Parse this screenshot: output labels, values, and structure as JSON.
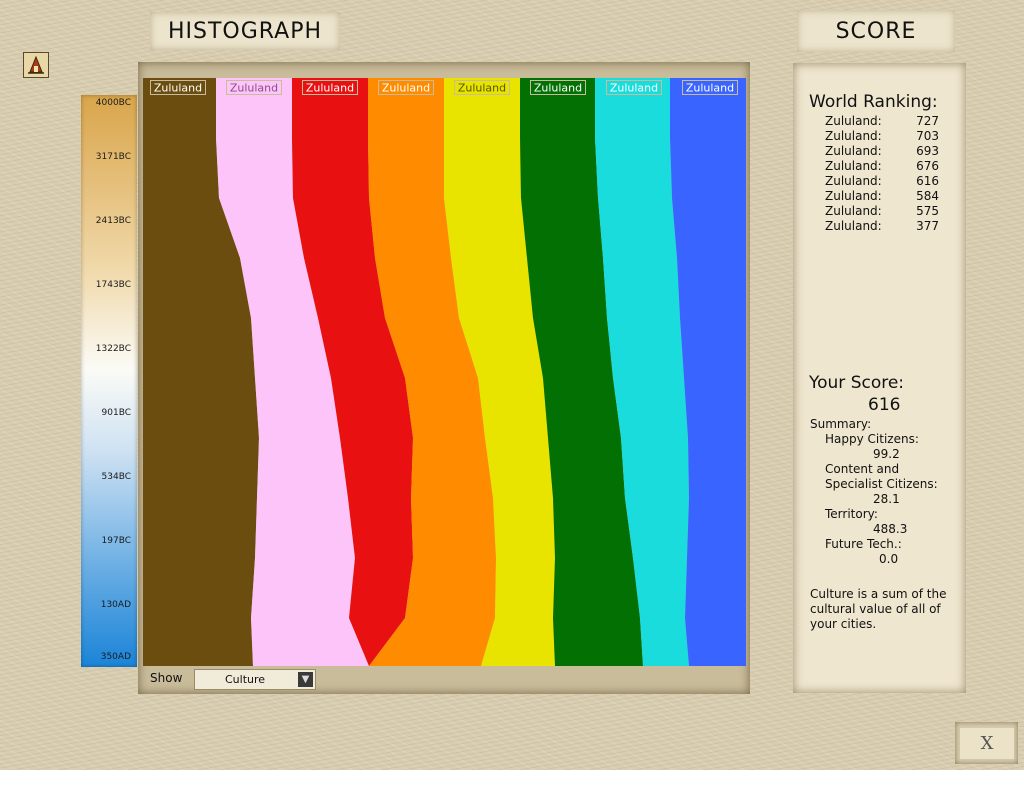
{
  "header": {
    "histograph_title": "HISTOGRAPH",
    "score_title": "SCORE"
  },
  "timeline": {
    "ticks": [
      "4000BC",
      "3171BC",
      "2413BC",
      "1743BC",
      "1322BC",
      "901BC",
      "534BC",
      "197BC",
      "130AD",
      "350AD"
    ]
  },
  "chart_data": {
    "type": "area",
    "title": "",
    "xlabel": "",
    "ylabel": "",
    "x": [
      "4000BC",
      "3171BC",
      "2413BC",
      "1743BC",
      "1322BC",
      "901BC",
      "534BC",
      "197BC",
      "130AD",
      "350AD"
    ],
    "stacked": true,
    "series": [
      {
        "name": "Zululand",
        "color": "#6b4e0f"
      },
      {
        "name": "Zululand",
        "color": "#fcc4f8"
      },
      {
        "name": "Zululand",
        "color": "#e81010"
      },
      {
        "name": "Zululand",
        "color": "#ff8c00"
      },
      {
        "name": "Zululand",
        "color": "#e8e400"
      },
      {
        "name": "Zululand",
        "color": "#037003"
      },
      {
        "name": "Zululand",
        "color": "#1adcdc"
      },
      {
        "name": "Zululand",
        "color": "#3a64ff"
      }
    ]
  },
  "show": {
    "label": "Show",
    "value": "Culture"
  },
  "ranking": {
    "title": "World Ranking:",
    "rows": [
      {
        "name": "Zululand:",
        "score": "727"
      },
      {
        "name": "Zululand:",
        "score": "703"
      },
      {
        "name": "Zululand:",
        "score": "693"
      },
      {
        "name": "Zululand:",
        "score": "676"
      },
      {
        "name": "Zululand:",
        "score": "616"
      },
      {
        "name": "Zululand:",
        "score": "584"
      },
      {
        "name": "Zululand:",
        "score": "575"
      },
      {
        "name": "Zululand:",
        "score": "377"
      }
    ]
  },
  "your_score": {
    "title": "Your Score:",
    "value": "616",
    "summary_label": "Summary:",
    "happy_label": "Happy Citizens:",
    "happy_value": "99.2",
    "content_label_1": "Content and",
    "content_label_2": "Specialist Citizens:",
    "content_value": "28.1",
    "territory_label": "Territory:",
    "territory_value": "488.3",
    "future_label": "Future Tech.:",
    "future_value": "0.0"
  },
  "note": "Culture is a sum of the cultural value of all of your cities.",
  "close_label": "X"
}
